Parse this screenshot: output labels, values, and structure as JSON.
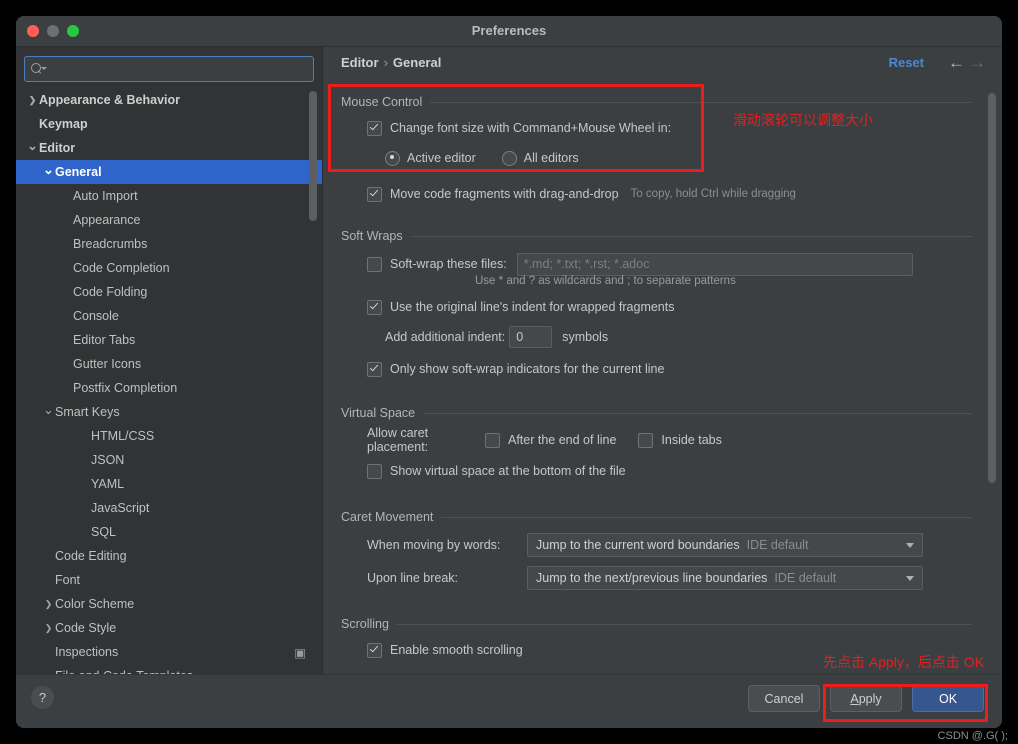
{
  "window": {
    "title": "Preferences"
  },
  "search": {
    "placeholder": "",
    "value": ""
  },
  "sidebar": {
    "items": [
      {
        "label": "Appearance & Behavior",
        "indent": 0,
        "arrow": "›",
        "bold": true,
        "selected": false
      },
      {
        "label": "Keymap",
        "indent": 0,
        "arrow": "",
        "bold": true,
        "selected": false
      },
      {
        "label": "Editor",
        "indent": 0,
        "arrow": "⌄",
        "bold": true,
        "selected": false
      },
      {
        "label": "General",
        "indent": 1,
        "arrow": "⌄",
        "bold": true,
        "selected": true
      },
      {
        "label": "Auto Import",
        "indent": 2,
        "arrow": "",
        "bold": false,
        "selected": false
      },
      {
        "label": "Appearance",
        "indent": 2,
        "arrow": "",
        "bold": false,
        "selected": false
      },
      {
        "label": "Breadcrumbs",
        "indent": 2,
        "arrow": "",
        "bold": false,
        "selected": false
      },
      {
        "label": "Code Completion",
        "indent": 2,
        "arrow": "",
        "bold": false,
        "selected": false
      },
      {
        "label": "Code Folding",
        "indent": 2,
        "arrow": "",
        "bold": false,
        "selected": false
      },
      {
        "label": "Console",
        "indent": 2,
        "arrow": "",
        "bold": false,
        "selected": false
      },
      {
        "label": "Editor Tabs",
        "indent": 2,
        "arrow": "",
        "bold": false,
        "selected": false
      },
      {
        "label": "Gutter Icons",
        "indent": 2,
        "arrow": "",
        "bold": false,
        "selected": false
      },
      {
        "label": "Postfix Completion",
        "indent": 2,
        "arrow": "",
        "bold": false,
        "selected": false
      },
      {
        "label": "Smart Keys",
        "indent": 1,
        "arrow": "⌄",
        "bold": false,
        "selected": false
      },
      {
        "label": "HTML/CSS",
        "indent": 3,
        "arrow": "",
        "bold": false,
        "selected": false
      },
      {
        "label": "JSON",
        "indent": 3,
        "arrow": "",
        "bold": false,
        "selected": false
      },
      {
        "label": "YAML",
        "indent": 3,
        "arrow": "",
        "bold": false,
        "selected": false
      },
      {
        "label": "JavaScript",
        "indent": 3,
        "arrow": "",
        "bold": false,
        "selected": false
      },
      {
        "label": "SQL",
        "indent": 3,
        "arrow": "",
        "bold": false,
        "selected": false
      },
      {
        "label": "Code Editing",
        "indent": 1,
        "arrow": "",
        "bold": false,
        "selected": false
      },
      {
        "label": "Font",
        "indent": 1,
        "arrow": "",
        "bold": false,
        "selected": false
      },
      {
        "label": "Color Scheme",
        "indent": 0,
        "arrow": "›",
        "bold": false,
        "selected": false,
        "indentOverride": 1
      },
      {
        "label": "Code Style",
        "indent": 0,
        "arrow": "›",
        "bold": false,
        "selected": false,
        "indentOverride": 1
      },
      {
        "label": "Inspections",
        "indent": 1,
        "arrow": "",
        "bold": false,
        "selected": false,
        "trail": "▣"
      },
      {
        "label": "File and Code Templates",
        "indent": 1,
        "arrow": "",
        "bold": false,
        "selected": false
      }
    ]
  },
  "breadcrumb": {
    "parent": "Editor",
    "separator": "›",
    "current": "General"
  },
  "header": {
    "reset_label": "Reset",
    "back_arrow": "←",
    "forward_arrow": "→"
  },
  "sections": {
    "mouse_control": {
      "title": "Mouse Control",
      "change_font_size_label": "Change font size with Command+Mouse Wheel in:",
      "change_font_size_checked": true,
      "radio_active_editor": "Active editor",
      "radio_all_editors": "All editors",
      "radio_selected": "Active editor",
      "move_fragments_label": "Move code fragments with drag-and-drop",
      "move_fragments_checked": true,
      "move_fragments_hint": "To copy, hold Ctrl while dragging"
    },
    "soft_wraps": {
      "title": "Soft Wraps",
      "softwrap_files_label": "Soft-wrap these files:",
      "softwrap_files_checked": false,
      "softwrap_files_placeholder": "*.md; *.txt; *.rst; *.adoc",
      "softwrap_files_value": "",
      "wildcards_hint": "Use * and ? as wildcards and ; to separate patterns",
      "original_indent_label": "Use the original line's indent for wrapped fragments",
      "original_indent_checked": true,
      "additional_indent_label": "Add additional indent:",
      "additional_indent_value": "0",
      "symbols_label": "symbols",
      "only_show_indicators_label": "Only show soft-wrap indicators for the current line",
      "only_show_indicators_checked": true
    },
    "virtual_space": {
      "title": "Virtual Space",
      "allow_caret_label": "Allow caret placement:",
      "after_end_label": "After the end of line",
      "after_end_checked": false,
      "inside_tabs_label": "Inside tabs",
      "inside_tabs_checked": false,
      "show_virtual_space_label": "Show virtual space at the bottom of the file",
      "show_virtual_space_checked": false
    },
    "caret_movement": {
      "title": "Caret Movement",
      "when_moving_label": "When moving by words:",
      "when_moving_value": "Jump to the current word boundaries",
      "when_moving_default": "IDE default",
      "upon_line_break_label": "Upon line break:",
      "upon_line_break_value": "Jump to the next/previous line boundaries",
      "upon_line_break_default": "IDE default"
    },
    "scrolling": {
      "title": "Scrolling",
      "smooth_scrolling_label": "Enable smooth scrolling",
      "smooth_scrolling_checked": true
    }
  },
  "footer": {
    "help_label": "?",
    "cancel_label": "Cancel",
    "apply_label": "Apply",
    "ok_label": "OK"
  },
  "annotations": {
    "mouse_wheel_note": "滑动滚轮可以调整大小",
    "apply_ok_note": "先点击 Apply，后点击 OK",
    "watermark": "CSDN @.G( );"
  },
  "colors": {
    "accent_blue": "#2f65ca",
    "link_blue": "#4a88d4",
    "annotation_red": "#e02222",
    "panel_bg": "#3c3f41",
    "sidebar_bg": "#313335"
  }
}
